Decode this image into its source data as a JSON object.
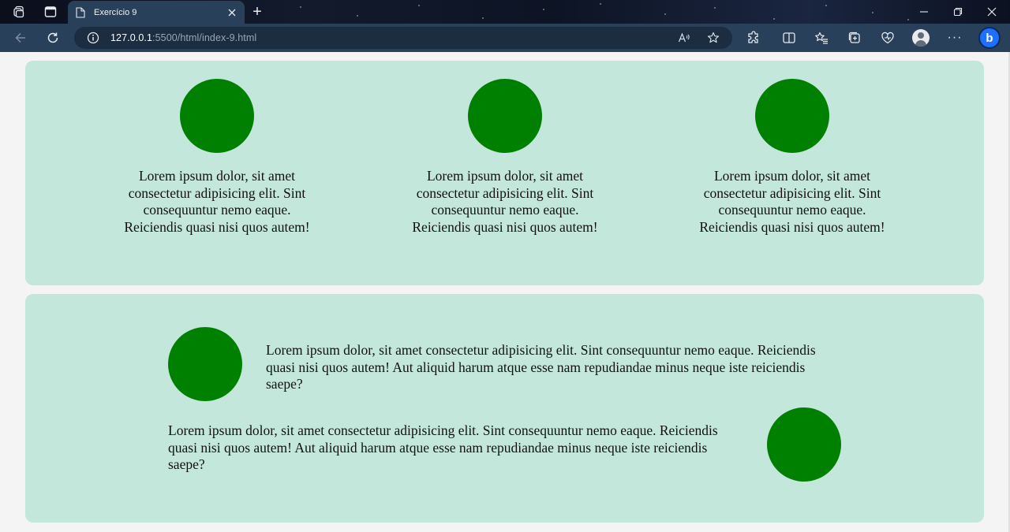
{
  "browser": {
    "tab_title": "Exercício 9",
    "url_host": "127.0.0.1",
    "url_rest": ":5500/html/index-9.html"
  },
  "colors": {
    "panel_bg": "#c4e7dc",
    "circle": "#008000",
    "page_bg": "#f4f4f4"
  },
  "panel_top": {
    "columns": [
      {
        "text": "Lorem ipsum dolor, sit amet consectetur adipisicing elit. Sint consequuntur nemo eaque. Reiciendis quasi nisi quos autem!"
      },
      {
        "text": "Lorem ipsum dolor, sit amet consectetur adipisicing elit. Sint consequuntur nemo eaque. Reiciendis quasi nisi quos autem!"
      },
      {
        "text": "Lorem ipsum dolor, sit amet consectetur adipisicing elit. Sint consequuntur nemo eaque. Reiciendis quasi nisi quos autem!"
      }
    ]
  },
  "panel_bottom": {
    "rows": [
      {
        "text": "Lorem ipsum dolor, sit amet consectetur adipisicing elit. Sint consequuntur nemo eaque. Reiciendis quasi nisi quos autem! Aut aliquid harum atque esse nam repudiandae minus neque iste reiciendis saepe?"
      },
      {
        "text": "Lorem ipsum dolor, sit amet consectetur adipisicing elit. Sint consequuntur nemo eaque. Reiciendis quasi nisi quos autem! Aut aliquid harum atque esse nam repudiandae minus neque iste reiciendis saepe?"
      }
    ]
  }
}
